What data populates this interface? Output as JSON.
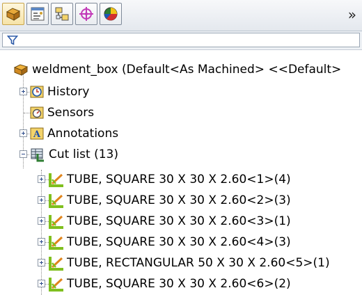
{
  "toolbar": {
    "tabs": [
      {
        "name": "feature-manager-icon",
        "active": true
      },
      {
        "name": "property-manager-icon",
        "active": false
      },
      {
        "name": "configuration-manager-icon",
        "active": false
      },
      {
        "name": "dimxpert-manager-icon",
        "active": false
      },
      {
        "name": "display-manager-icon",
        "active": false
      }
    ],
    "overflow_glyph": "»"
  },
  "filter": {
    "icon": "filter-icon",
    "value": ""
  },
  "tree": {
    "root": "weldment_box  (Default<As Machined> <<Default>",
    "items": [
      {
        "label": "History",
        "icon": "history-icon"
      },
      {
        "label": "Sensors",
        "icon": "sensors-icon"
      },
      {
        "label": "Annotations",
        "icon": "annotations-icon"
      },
      {
        "label": "Cut list (13)",
        "icon": "cut-list-icon"
      }
    ],
    "cutlist_items": [
      {
        "label": "TUBE, SQUARE 30 X 30 X 2.60<1>(4)"
      },
      {
        "label": "TUBE, SQUARE 30 X 30 X 2.60<2>(3)"
      },
      {
        "label": "TUBE, SQUARE 30 X 30 X 2.60<3>(1)"
      },
      {
        "label": "TUBE, SQUARE 30 X 30 X 2.60<4>(3)"
      },
      {
        "label": "TUBE, RECTANGULAR 50 X 30 X 2.60<5>(1)"
      },
      {
        "label": "TUBE, SQUARE 30 X 30 X 2.60<6>(2)"
      }
    ]
  },
  "colors": {
    "toolbar_bg": "#e4e8ee",
    "active_tab": "#f6e3a8",
    "weldment_green": "#7fbf1e",
    "weldment_orange": "#e0851c"
  }
}
